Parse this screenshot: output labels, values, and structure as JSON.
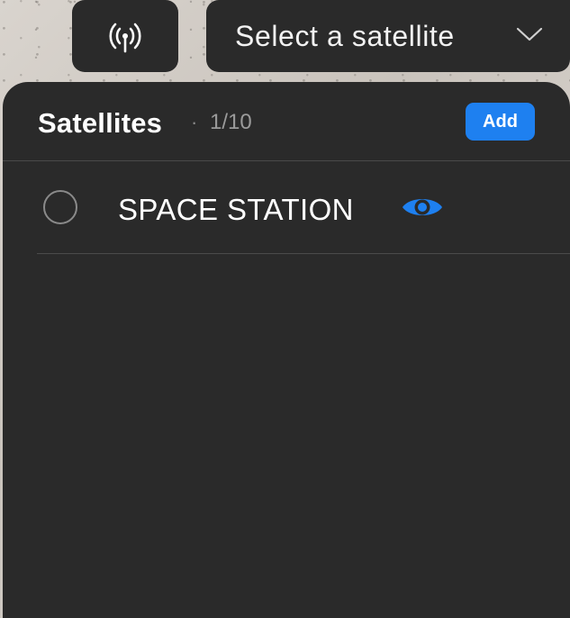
{
  "toolbar": {
    "antenna_icon": "antenna-signal-icon",
    "select_placeholder": "Select a satellite",
    "chevron_icon": "chevron-down-icon"
  },
  "panel": {
    "title": "Satellites",
    "separator": "·",
    "count": "1/10",
    "add_label": "Add"
  },
  "satellites": [
    {
      "name": "SPACE STATION",
      "selected": false,
      "visible": true,
      "visibility_icon": "eye-icon"
    }
  ],
  "colors": {
    "accent": "#1e80f0",
    "panel_bg": "#2a2a2a",
    "divider": "#4a4a4a",
    "text_primary": "#ffffff",
    "text_secondary": "#9a9a9a"
  }
}
